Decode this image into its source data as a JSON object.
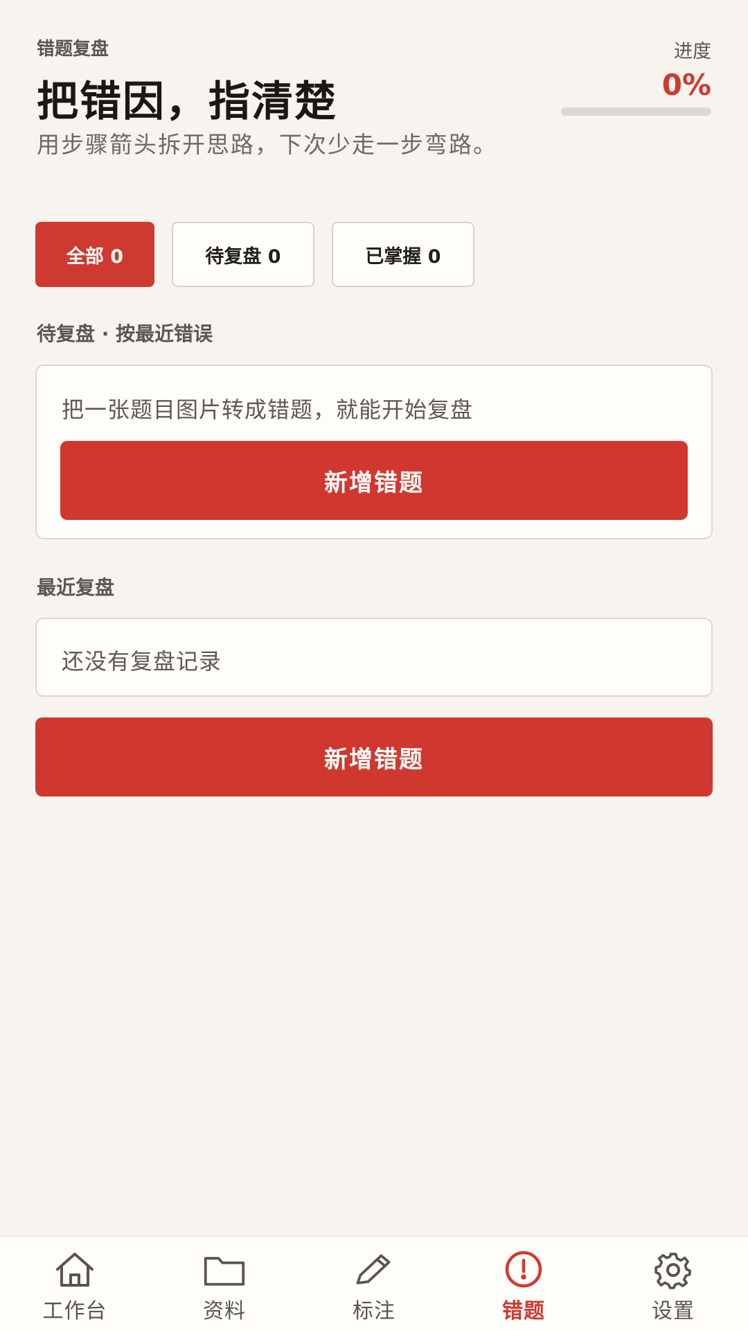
{
  "header": {
    "eyebrow": "错题复盘",
    "headline": "把错因，指清楚",
    "subtitle": "用步骤箭头拆开思路，下次少走一步弯路。",
    "progress_label": "进度",
    "progress_value": "0%",
    "progress_fraction": 0
  },
  "filters": [
    {
      "label": "全部 0",
      "active": true
    },
    {
      "label": "待复盘 0",
      "active": false
    },
    {
      "label": "已掌握 0",
      "active": false
    }
  ],
  "pending": {
    "title": "待复盘 · 按最近错误",
    "empty_text": "把一张题目图片转成错题，就能开始复盘",
    "button_label": "新增错题"
  },
  "recent": {
    "title": "最近复盘",
    "empty_text": "还没有复盘记录",
    "button_label": "新增错题"
  },
  "nav": [
    {
      "label": "工作台",
      "icon": "home-icon",
      "active": false
    },
    {
      "label": "资料",
      "icon": "folder-icon",
      "active": false
    },
    {
      "label": "标注",
      "icon": "pen-icon",
      "active": false
    },
    {
      "label": "错题",
      "icon": "alert-icon",
      "active": true
    },
    {
      "label": "设置",
      "icon": "gear-icon",
      "active": false
    }
  ],
  "colors": {
    "accent": "#cf3a30",
    "background": "#f7f3ee",
    "card": "#fffdfa"
  }
}
